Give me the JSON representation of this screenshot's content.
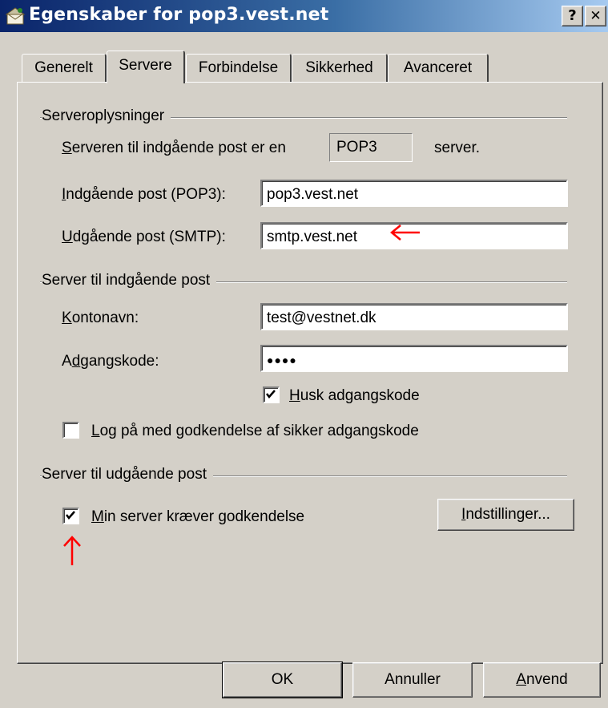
{
  "window": {
    "title": "Egenskaber for pop3.vest.net",
    "help_label": "?",
    "close_label": "✕"
  },
  "tabs": [
    {
      "label": "Generelt"
    },
    {
      "label": "Servere"
    },
    {
      "label": "Forbindelse"
    },
    {
      "label": "Sikkerhed"
    },
    {
      "label": "Avanceret"
    }
  ],
  "server_info": {
    "group_label": "Serveroplysninger",
    "incoming_type_prefix": "erveren til indgående post er en",
    "incoming_type_mnemonic": "S",
    "incoming_type_value": "POP3",
    "incoming_type_suffix": "server.",
    "incoming_label_mnemonic": "I",
    "incoming_label": "ndgående post (POP3):",
    "incoming_value": "pop3.vest.net",
    "outgoing_label_mnemonic": "U",
    "outgoing_label": "dgående post (SMTP):",
    "outgoing_value": "smtp.vest.net"
  },
  "incoming_server": {
    "group_label": "Server til indgående post",
    "account_label_mnemonic": "K",
    "account_label": "ontonavn:",
    "account_value": "test@vestnet.dk",
    "password_label_a": "A",
    "password_label_mnemonic": "d",
    "password_label_b": "gangskode:",
    "password_value": "●●●●",
    "remember_mnemonic": "H",
    "remember_label": "usk adgangskode",
    "remember_checked": true,
    "spa_mnemonic": "L",
    "spa_label": "og på med godkendelse af sikker adgangskode",
    "spa_checked": false
  },
  "outgoing_server": {
    "group_label": "Server til udgående post",
    "auth_mnemonic": "M",
    "auth_label": "in server kræver godkendelse",
    "auth_checked": true,
    "settings_mnemonic": "I",
    "settings_label": "ndstillinger..."
  },
  "buttons": {
    "ok": "OK",
    "cancel": "Annuller",
    "apply_mnemonic": "A",
    "apply": "nvend"
  },
  "annotation_color": "#ff0000"
}
